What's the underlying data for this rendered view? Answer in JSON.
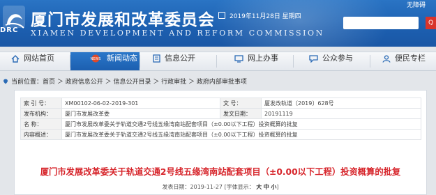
{
  "header": {
    "title": "厦门市发展和改革委员会",
    "subtitle": "XIAMEN DEVELOPMENT AND REFORM COMMISSION",
    "logo_text": "DRC",
    "date": "2019年11月28日 星期四",
    "top_right_text": "无障碍",
    "search_button": "Q"
  },
  "nav": {
    "items": [
      {
        "label": "网站首页",
        "icon": "home-icon"
      },
      {
        "label": "新闻动态",
        "icon": "news-icon",
        "active": true
      },
      {
        "label": "信息公开",
        "icon": "document-icon"
      },
      {
        "label": "网上办事",
        "icon": "monitor-icon"
      },
      {
        "label": "公众参与",
        "icon": "chat-icon"
      },
      {
        "label": "便民专栏",
        "icon": "service-icon"
      }
    ]
  },
  "breadcrumb": {
    "prefix": "当前位置：",
    "path": "首页 ＞ 政府信息公开 ＞ 信息公开目录 ＞ 行政审批 ＞ 政府内部审批事项"
  },
  "meta": {
    "index_label": "索 引 号：",
    "index_value": "XM00102-06-02-2019-301",
    "docno_label": "文 号：",
    "docno_value": "厦发改轨道〔2019〕628号",
    "org_label": "发布机构：",
    "org_value": "厦门市发展改革委",
    "date_label": "发文日期：",
    "date_value": "20191119",
    "name_label": "名 称：",
    "name_value": "厦门市发展改革委关于轨道交通2号线五缘湾南站配套项目（±0.00以下工程）投资概算的批复",
    "summary_label": "内容概述：",
    "summary_value": "厦门市发展改革委关于轨道交通2号线五缘湾南站配套项目（±0.00以下工程）投资概算的批复"
  },
  "document": {
    "title": "厦门市发展改革委关于轨道交通2号线五缘湾南站配套项目（±0.00以下工程）投资概算的批复",
    "publish": "发表日期：2019-11-27 [字体显示：",
    "font_big": "大",
    "font_mid": "中",
    "font_small": "小",
    "publish_end": "]"
  },
  "colors": {
    "banner": "#1c5fb0",
    "title_red": "#d7262c",
    "nav_active": "#1c5fb0"
  }
}
